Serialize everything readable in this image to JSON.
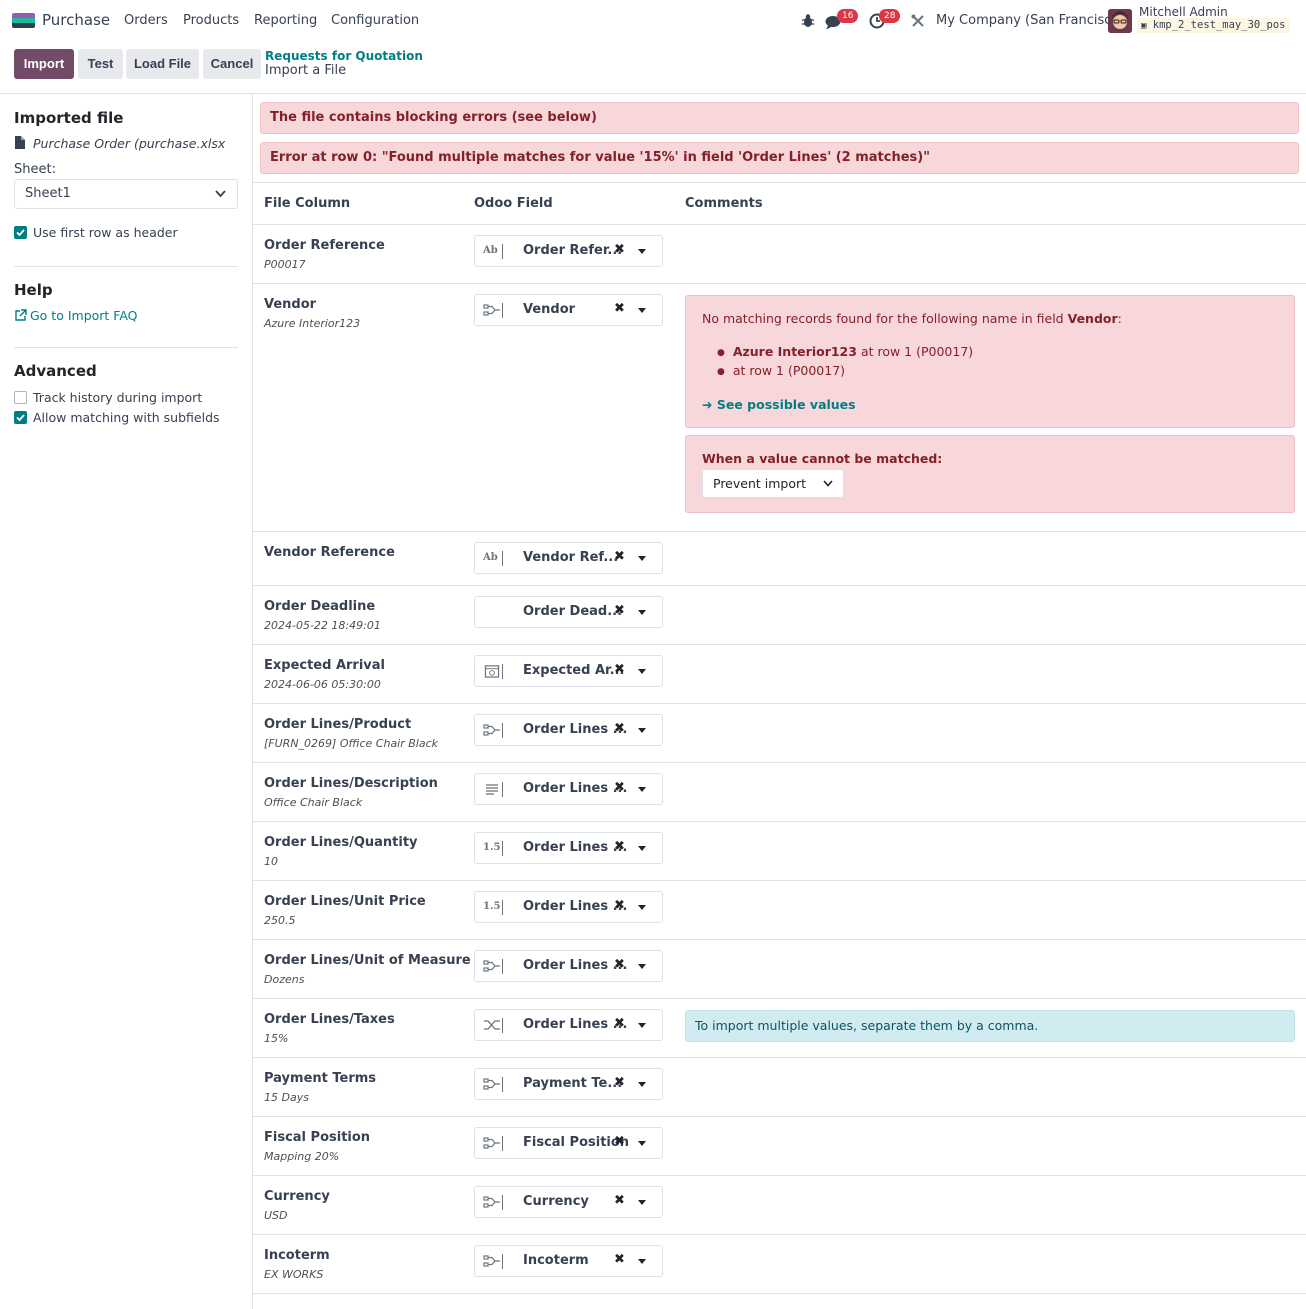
{
  "navbar": {
    "app_name": "Purchase",
    "menu": [
      "Orders",
      "Products",
      "Reporting",
      "Configuration"
    ],
    "messages_count": "16",
    "activities_count": "28",
    "company": "My Company (San Francisco)",
    "user_name": "Mitchell Admin",
    "database": "kmp_2_test_may_30_pos"
  },
  "control_panel": {
    "buttons": {
      "import": "Import",
      "test": "Test",
      "load_file": "Load File",
      "cancel": "Cancel"
    },
    "breadcrumb_parent": "Requests for Quotation",
    "breadcrumb_current": "Import a File"
  },
  "sidebar": {
    "imported_file_title": "Imported file",
    "file_name": "Purchase Order (purchase.xlsx",
    "sheet_label": "Sheet:",
    "sheet_value": "Sheet1",
    "first_row_header_label": "Use first row as header",
    "first_row_header_checked": true,
    "help_title": "Help",
    "faq_link": "Go to Import FAQ",
    "advanced_title": "Advanced",
    "track_history_label": "Track history during import",
    "track_history_checked": false,
    "allow_subfields_label": "Allow matching with subfields",
    "allow_subfields_checked": true
  },
  "alerts": {
    "blocking": "The file contains blocking errors (see below)",
    "row_error": "Error at row 0: \"Found multiple matches for value '15%' in field 'Order Lines' (2 matches)\""
  },
  "table": {
    "headers": {
      "file_column": "File Column",
      "odoo_field": "Odoo Field",
      "comments": "Comments"
    },
    "rows": [
      {
        "name": "Order Reference",
        "sample": "P00017",
        "field": "Order Refer...",
        "icon": "text-icon"
      },
      {
        "name": "Vendor",
        "sample": "Azure Interior123",
        "field": "Vendor",
        "icon": "relation-icon"
      },
      {
        "name": "Vendor Reference",
        "sample": "",
        "field": "Vendor Ref...",
        "icon": "text-icon"
      },
      {
        "name": "Order Deadline",
        "sample": "2024-05-22 18:49:01",
        "field": "Order Dead...",
        "icon": "none"
      },
      {
        "name": "Expected Arrival",
        "sample": "2024-06-06 05:30:00",
        "field": "Expected Ar...",
        "icon": "calendar-icon"
      },
      {
        "name": "Order Lines/Product",
        "sample": "[FURN_0269] Office Chair Black",
        "field": "Order Lines ...",
        "icon": "relation-icon"
      },
      {
        "name": "Order Lines/Description",
        "sample": "Office Chair Black",
        "field": "Order Lines ...",
        "icon": "lines-icon"
      },
      {
        "name": "Order Lines/Quantity",
        "sample": "10",
        "field": "Order Lines ...",
        "icon": "float-icon"
      },
      {
        "name": "Order Lines/Unit Price",
        "sample": "250.5",
        "field": "Order Lines ...",
        "icon": "float-icon"
      },
      {
        "name": "Order Lines/Unit of Measure",
        "sample": "Dozens",
        "field": "Order Lines ...",
        "icon": "relation-icon"
      },
      {
        "name": "Order Lines/Taxes",
        "sample": "15%",
        "field": "Order Lines ...",
        "icon": "many2many-icon"
      },
      {
        "name": "Payment Terms",
        "sample": "15 Days",
        "field": "Payment Te...",
        "icon": "relation-icon"
      },
      {
        "name": "Fiscal Position",
        "sample": "Mapping 20%",
        "field": "Fiscal Position",
        "icon": "relation-icon"
      },
      {
        "name": "Currency",
        "sample": "USD",
        "field": "Currency",
        "icon": "relation-icon"
      },
      {
        "name": "Incoterm",
        "sample": "EX WORKS",
        "field": "Incoterm",
        "icon": "relation-icon"
      }
    ]
  },
  "vendor_comment": {
    "intro": "No matching records found for the following name in field",
    "field_name": "Vendor",
    "colon": ":",
    "item1_value": "Azure Interior123",
    "item1_rest": "at row 1 (P00017)",
    "item2": "at row 1 (P00017)",
    "possible_values_link": "See possible values",
    "unmatched_title": "When a value cannot be matched:",
    "unmatched_option": "Prevent import"
  },
  "taxes_comment": "To import multiple values, separate them by a comma.",
  "colors": {
    "brand": "#714b67",
    "accent": "#017e84",
    "danger_bg": "#f8d7da",
    "danger_text": "#842029",
    "info_bg": "#d1ecf1"
  }
}
